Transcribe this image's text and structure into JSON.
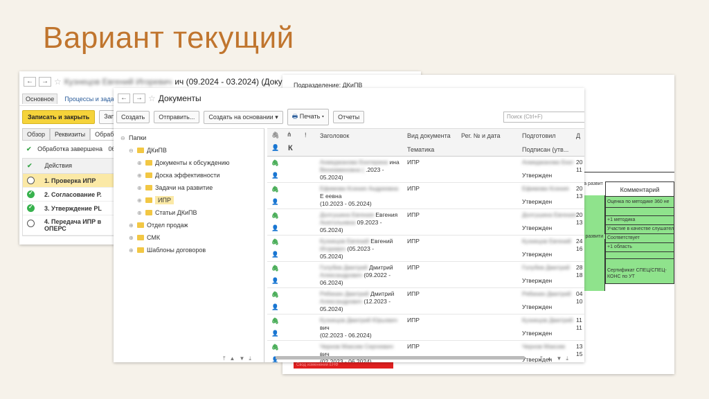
{
  "slide": {
    "title": "Вариант текущий"
  },
  "w1": {
    "title_blur": "Кузнецов Евгений Игоревич",
    "title": "ич (09.2024 - 03.2024) (Доку",
    "tabs": [
      "Основное",
      "Процессы и задачи"
    ],
    "save_close": "Записать и закрыть",
    "save": "Запи",
    "subtabs": [
      "Обзор",
      "Реквизиты",
      "Обраб"
    ],
    "status": "Обработка завершена",
    "status_date": "06",
    "actions_header": "Действия",
    "steps": [
      {
        "label": "1. Проверка ИПР",
        "state": "outline"
      },
      {
        "label": "2. Согласование Р.",
        "state": "ok"
      },
      {
        "label": "3. Утверждение PL",
        "state": "ok"
      },
      {
        "label": "4. Передача ИПР в ОПЕРС",
        "state": "outline"
      }
    ]
  },
  "w3": {
    "podr": "Подразделение: ДКиПВ",
    "kommentariy": "Комментарий",
    "razvit1": "ка развит",
    "razvit2": "у развити",
    "rows": [
      "Оценка по методике 360 не",
      "",
      "+1 методика",
      "Участие в качестве слушател",
      "Соответствует",
      "+1 область",
      "",
      "Сертификат СПЕЦ/СПЕЦ-КОНС по УТ"
    ],
    "red_text": "Свод изменений ЕНФ"
  },
  "w2": {
    "title": "Документы",
    "buttons": {
      "create": "Создать",
      "send": "Отправить...",
      "based_on": "Создать на основании",
      "print": "Печать",
      "reports": "Отчеты"
    },
    "search_placeholder": "Поиск (Ctrl+F)",
    "tree": [
      {
        "label": "Папки",
        "level": 0,
        "pm": "⊖",
        "folder": false
      },
      {
        "label": "ДКиПВ",
        "level": 1,
        "pm": "⊖",
        "folder": true
      },
      {
        "label": "Документы к обсуждению",
        "level": 2,
        "pm": "⊕",
        "folder": true
      },
      {
        "label": "Доска эффективности",
        "level": 2,
        "pm": "⊕",
        "folder": true
      },
      {
        "label": "Задачи на развитие",
        "level": 2,
        "pm": "⊕",
        "folder": true
      },
      {
        "label": "ИПР",
        "level": 2,
        "pm": "⊕",
        "folder": true,
        "selected": true
      },
      {
        "label": "Статьи ДКиПВ",
        "level": 2,
        "pm": "⊕",
        "folder": true
      },
      {
        "label": "Отдел продаж",
        "level": 1,
        "pm": "⊕",
        "folder": true
      },
      {
        "label": "СМК",
        "level": 1,
        "pm": "⊕",
        "folder": true
      },
      {
        "label": "Шаблоны договоров",
        "level": 1,
        "pm": "⊕",
        "folder": true
      }
    ],
    "headers": {
      "k": "К",
      "excl": "!",
      "title": "Заголовок",
      "doctype": "Вид документа",
      "doctype2": "Тематика",
      "regnum": "Рег. № и дата",
      "prepared": "Подготовил",
      "signed": "Подписан (утв...",
      "d": "Д"
    },
    "rows": [
      {
        "blur1": "Ахмеджанова Екатерина",
        "vis1": "ина",
        "blur2": "Вениаминовна (",
        "vis2": ".2023 -",
        "line3": "05.2024)",
        "type": "ИПР",
        "prep_blur": "Ахмеджанова Екат",
        "status": "Утвержден",
        "d1": "20",
        "d2": "11"
      },
      {
        "blur1": "Ефимова Ксения Андреевна",
        "vis1": "Е",
        "vis1b": "еевна",
        "line2": "(10.2023 - 05.2024)",
        "type": "ИПР",
        "prep_blur": "Ефимова Ксения",
        "status": "Утвержден",
        "d1": "20",
        "d2": "13"
      },
      {
        "blur1": "Долгушина Евгения",
        "vis1": "Евгения",
        "blur2": "Анатольевна",
        "vis2": "09.2023 -",
        "line3": "05.2024)",
        "type": "ИПР",
        "prep_blur": "Долгушина Евгения",
        "status": "Утвержден",
        "d1": "20",
        "d2": "13"
      },
      {
        "blur1": "Кузнецов Евгений",
        "vis1": "Евгений",
        "blur2": "Игоревич",
        "vis2": "(05.2023 -",
        "line3": "05.2024)",
        "type": "ИПР",
        "prep_blur": "Кузнецов Евгений",
        "status": "Утвержден",
        "d1": "24",
        "d2": "16"
      },
      {
        "blur1": "Голубев Дмитрий",
        "vis1": "Дмитрий",
        "blur2": "Александрович",
        "vis2": "(09.2022 -",
        "line3": "06.2024)",
        "type": "ИПР",
        "prep_blur": "Голубев Дмитрий",
        "status": "Утвержден",
        "d1": "28",
        "d2": "18"
      },
      {
        "blur1": "Рябинин Дмитрий",
        "vis1": "Дмитрий",
        "blur2": "Александрович",
        "vis2": "(12.2023 -",
        "line3": "05.2024)",
        "type": "ИПР",
        "prep_blur": "Рябинин Дмитрий",
        "status": "Утвержден",
        "d1": "04",
        "d2": "10"
      },
      {
        "blur1": "Кузнецов Дмитрий Юрьевич",
        "vis1": "вич",
        "line2": "(02.2023 - 06.2024)",
        "type": "ИПР",
        "prep_blur": "Кузнецов Дмитрий",
        "status": "Утвержден",
        "d1": "11",
        "d2": "11"
      },
      {
        "blur1": "Чернов Максим Сергеевич",
        "vis1": "вич",
        "line2": "(02.2023 - 06.2024)",
        "type": "ИПР",
        "prep_blur": "Чернов Максим",
        "status": "Утвержден",
        "d1": "13",
        "d2": "15"
      }
    ]
  }
}
